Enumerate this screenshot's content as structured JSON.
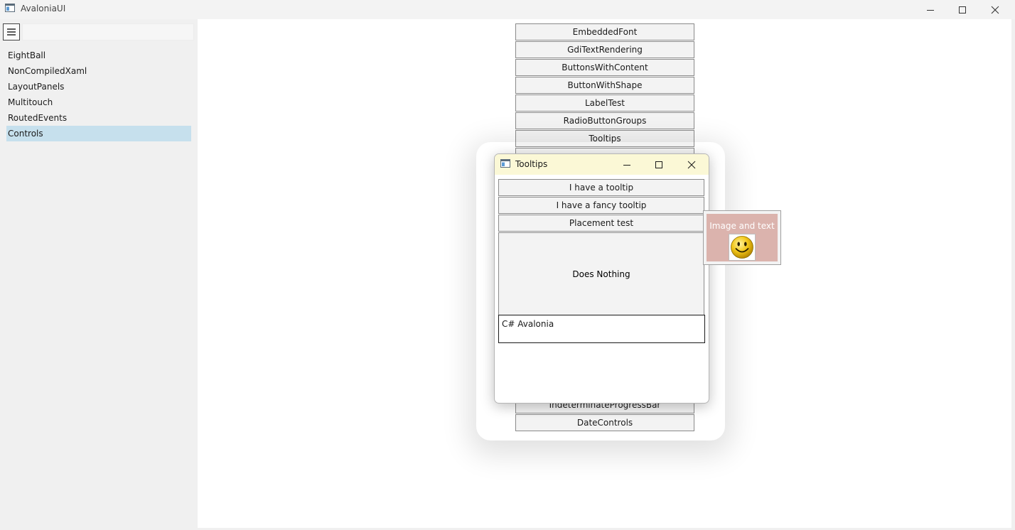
{
  "window": {
    "title": "AvaloniaUI"
  },
  "sidebar": {
    "search": {
      "value": "",
      "placeholder": ""
    },
    "items": [
      {
        "label": "EightBall"
      },
      {
        "label": "NonCompiledXaml"
      },
      {
        "label": "LayoutPanels"
      },
      {
        "label": "Multitouch"
      },
      {
        "label": "RoutedEvents"
      },
      {
        "label": "Controls",
        "selected": true
      }
    ]
  },
  "content": {
    "buttons_top": [
      "EmbeddedFont",
      "GdiTextRendering",
      "ButtonsWithContent",
      "ButtonWithShape",
      "LabelTest",
      "RadioButtonGroups",
      "Tooltips"
    ],
    "buttons_bottom": [
      "IndeterminateProgressBar",
      "DateControls"
    ]
  },
  "dialog": {
    "title": "Tooltips",
    "buttons": [
      "I have a tooltip",
      "I have a fancy tooltip",
      "Placement test"
    ],
    "does_nothing_label": "Does Nothing",
    "textbox_value": "C# Avalonia"
  },
  "tooltip": {
    "text": "Image and text",
    "image_icon": "smiley-face-icon"
  },
  "colors": {
    "selection": "#c6e0ed",
    "dialog_titlebar": "#fbf8d6",
    "tooltip_background": "#dbb3ad"
  }
}
